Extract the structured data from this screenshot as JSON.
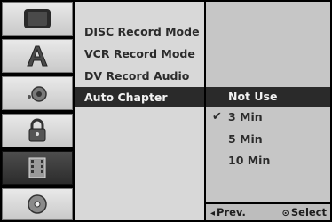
{
  "sidebar": {
    "icons": [
      {
        "name": "tv-icon",
        "active": false
      },
      {
        "name": "language-icon",
        "active": false
      },
      {
        "name": "audio-icon",
        "active": false
      },
      {
        "name": "lock-icon",
        "active": false
      },
      {
        "name": "recording-icon",
        "active": true
      },
      {
        "name": "disc-icon",
        "active": false
      }
    ]
  },
  "menu": {
    "items": [
      {
        "label": "DISC Record Mode"
      },
      {
        "label": "VCR Record Mode"
      },
      {
        "label": "DV Record Audio"
      },
      {
        "label": "Auto Chapter"
      }
    ],
    "selected_index": 3
  },
  "options": {
    "items": [
      {
        "label": "Not Use"
      },
      {
        "label": "3 Min"
      },
      {
        "label": "5 Min"
      },
      {
        "label": "10 Min"
      }
    ],
    "checked_index": 1,
    "check_glyph": "✔"
  },
  "footer": {
    "prev_glyph": "◂",
    "prev_label": "Prev.",
    "select_glyph": "⊙",
    "select_label": "Select"
  },
  "colors": {
    "selected_bg": "#2a2a2a",
    "menu_bg": "#d8d8d8",
    "options_bg": "#c6c6c6"
  }
}
